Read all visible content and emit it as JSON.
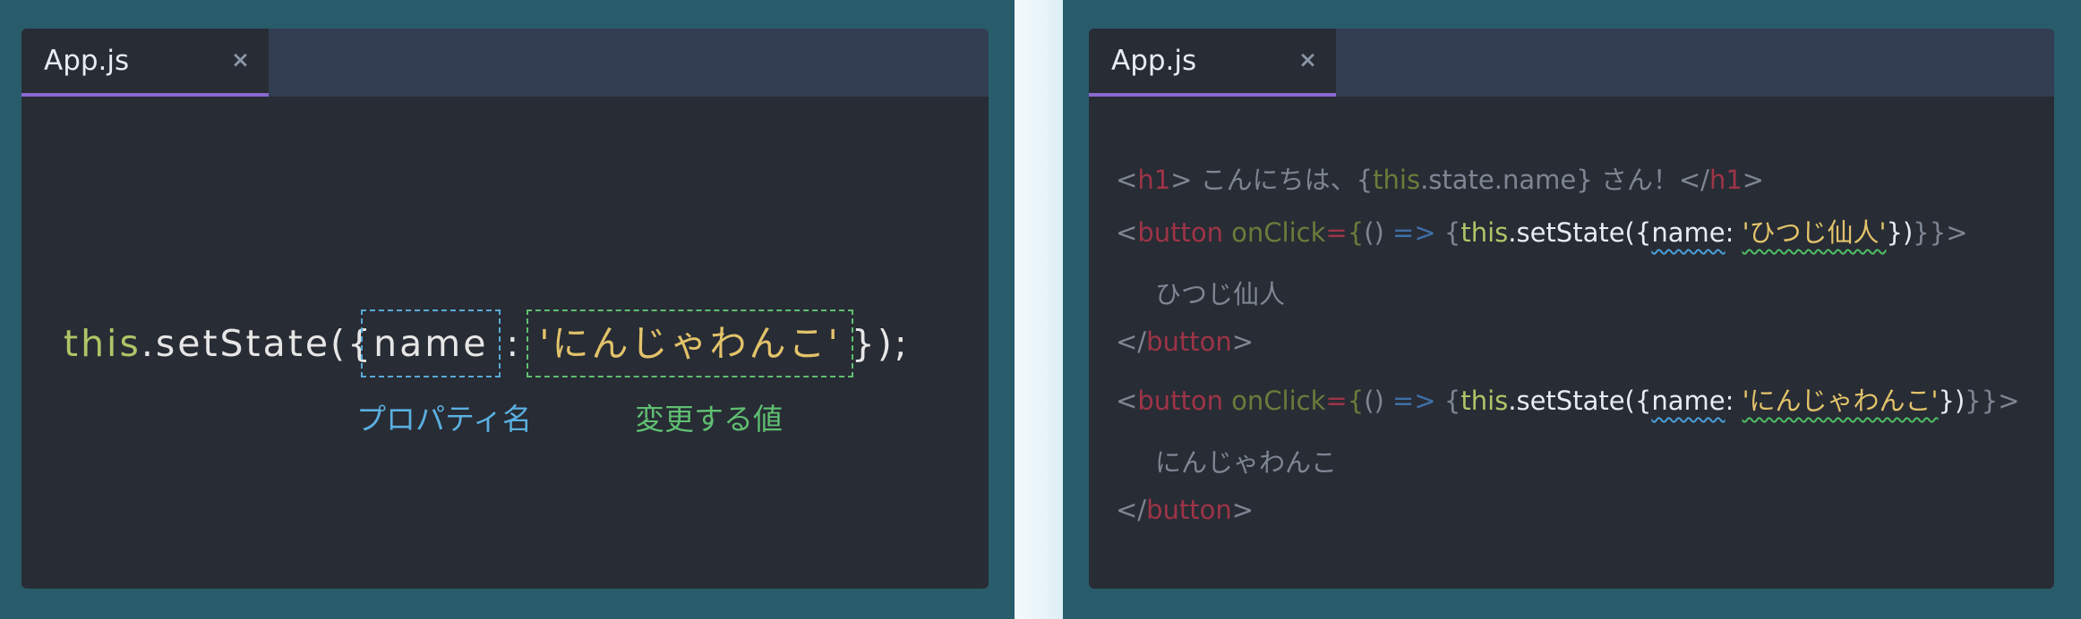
{
  "left_editor": {
    "tab": {
      "label": "App.js",
      "close": "×"
    },
    "code": {
      "this": "this",
      "method": ".setState({",
      "key": "name",
      "colon": ":",
      "value": "'にんじゃわんこ'",
      "end": "});"
    },
    "annotations": {
      "property": "プロパティ名",
      "value": "変更する値"
    }
  },
  "right_editor": {
    "tab": {
      "label": "App.js",
      "close": "×"
    },
    "line1": {
      "lt": "<",
      "tag": "h1",
      "gt": ">",
      "text": " こんにちは、{",
      "this": "this",
      "rest": ".state.name} さん！",
      "close_open": "</",
      "close_tag": "h1",
      "close_gt": ">"
    },
    "line2": {
      "lt": "<",
      "tag": "button",
      "attr": " onClick",
      "eq": "=",
      "brace": "{",
      "paren": "() ",
      "arrow": "=>",
      "brace2": " {",
      "this": "this",
      "call": ".setState(",
      "ob": "{",
      "key": "name",
      "colon": ": ",
      "value": "'ひつじ仙人'",
      "cb": "})",
      "tail": "}}>"
    },
    "line3": {
      "text": "ひつじ仙人"
    },
    "line4": {
      "open": "</",
      "tag": "button",
      "gt": ">"
    },
    "line5": {
      "lt": "<",
      "tag": "button",
      "attr": " onClick",
      "eq": "=",
      "brace": "{",
      "paren": "() ",
      "arrow": "=>",
      "brace2": " {",
      "this": "this",
      "call": ".setState(",
      "ob": "{",
      "key": "name",
      "colon": ": ",
      "value": "'にんじゃわんこ'",
      "cb": "})",
      "tail": "}}>"
    },
    "line6": {
      "text": "にんじゃわんこ"
    },
    "line7": {
      "open": "</",
      "tag": "button",
      "gt": ">"
    }
  }
}
